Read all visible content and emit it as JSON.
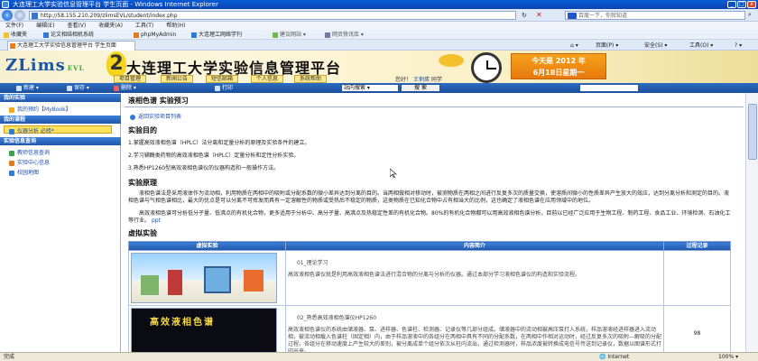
{
  "window": {
    "title": "大连理工大学实验信息管理平台 学生页面 - Windows Internet Explorer"
  },
  "browser": {
    "address": "http://58.155.210.209/zlimsEVL/student/index.php",
    "search_placeholder": "百度一下，你就知道",
    "menu": [
      "文件(F)",
      "编辑(E)",
      "查看(V)",
      "收藏夹(A)",
      "工具(T)",
      "帮助(H)"
    ],
    "favorites": [
      {
        "label": "收藏夹"
      },
      {
        "label": "论文相结相机系统"
      },
      {
        "label": "phpMyAdmin"
      },
      {
        "label": "大连理工网络学刊"
      },
      {
        "label": "建议网站 ▾"
      },
      {
        "label": "网页快讯库 ▾"
      }
    ],
    "tab_title": "大连理工大学实验信息管理平台 学生页面",
    "commands": [
      "页面(P) ▾",
      "安全(S) ▾",
      "工具(O) ▾"
    ],
    "status_left": "完成",
    "status_zone": "Internet",
    "status_zoom": "100%"
  },
  "banner": {
    "logo_text": "ZLims",
    "logo_sub": "EVL",
    "title": "大连理工大学实验信息管理平台",
    "date_line1": "今天是 2012 年",
    "date_line2": "6月18日星期一",
    "nav_tabs": [
      "项目管理",
      "新闻公告",
      "短信邮箱",
      "个人信息",
      "系统帮助"
    ],
    "user_greeting": "您好！",
    "user_name": "王俐烯",
    "user_role": "同学"
  },
  "toolbar": {
    "items": [
      "新建 ▾",
      "保存 ▾",
      "删除 ▾",
      "打印"
    ],
    "select_value": "站内搜索",
    "search_button": "搜 索"
  },
  "sidebar": {
    "section1": "我的实验",
    "item_mybook": "我的预约【MyBook】",
    "section2": "我的课程",
    "item_course": "仪器分析 必修*",
    "section3": "实验信息查询",
    "item_teacher": "教师信息查询",
    "item_center": "实验中心信息",
    "item_map": "校园地图"
  },
  "content": {
    "page_title": "液相色谱 实验预习",
    "back_link": "返回实验项目列表",
    "sec_purpose": "实验目的",
    "purpose_1": "1.掌握高效液相色谱（HPLC）法分离和定量分析的原理及实验条件的建立。",
    "purpose_2": "2.学习辅酶类药物的高效液相色谱（HPLC）定量分析和定性分析实验。",
    "purpose_3": "3.熟悉HP1260型高效液相色谱仪的仪器构造和一般操作方法。",
    "sec_principle": "实验原理",
    "principle_1": "液相色谱法是采用液体作为流动相，利用物质在两相中的吸附或分配系数的微小差异达到分离的目的。当两相做相对移动时，被测物质在两相之间进行反复多次的质量交换，使溶质间微小的性质差异产生放大的效应，达到分离分析和测定的目的。液相色谱与气相色谱相比，最大的优点是可以分离不可挥发而具有一定溶解性的物质或受热后不稳定的物质，这类物质在已知化合物中占有相当大的比例，这也确定了液相色谱在应用领域中的地位。",
    "principle_2": "高效液相色谱可分析低分子量、低沸点的有机化合物，更多适用于分析中、高分子量、高沸点及热稳定性差的有机化合物。80%的有机化合物都可以用高效液相色谱分析，目前以已经广泛应用于生物工程、制药工程、食品工业、环境检测、石油化工等行业。",
    "principle_ppt": "ppt",
    "sec_virtual": "虚拟实验",
    "table_headers": [
      "虚拟实验",
      "内容简介",
      "过程记录"
    ],
    "rows": [
      {
        "title": "01_理论学习",
        "desc": "高效液相色谱仪就是利用高效液相色谱法进行混合物的分离与分析的仪器。通过本部分学习液相色谱仪的构造和实验流程。",
        "count": ""
      },
      {
        "title": "02_熟悉高效液相色谱仪HP1260",
        "desc": "高效液相色谱仪的系统由储液器、泵、进样器、色谱柱、检测器、记录仪等几部分组成。储液器中的流动相被高压泵打入系统，样品溶液经进样器进入流动相，被流动相载入色谱柱（固定相）内，由于样品溶液中的各组分在两相中具有不同的分配系数，在两相中作相对运动时，经过反复多次的吸附—解吸的分配过程，各组分在移动速度上产生较大的差别，被分离成单个组分依次从柱内流出，通过检测器时，样品浓度被转换成电信号传送到记录仪，数据以图谱形式打印出来。",
        "count": "98"
      }
    ],
    "thumb2_text": "高效液相色谱"
  }
}
